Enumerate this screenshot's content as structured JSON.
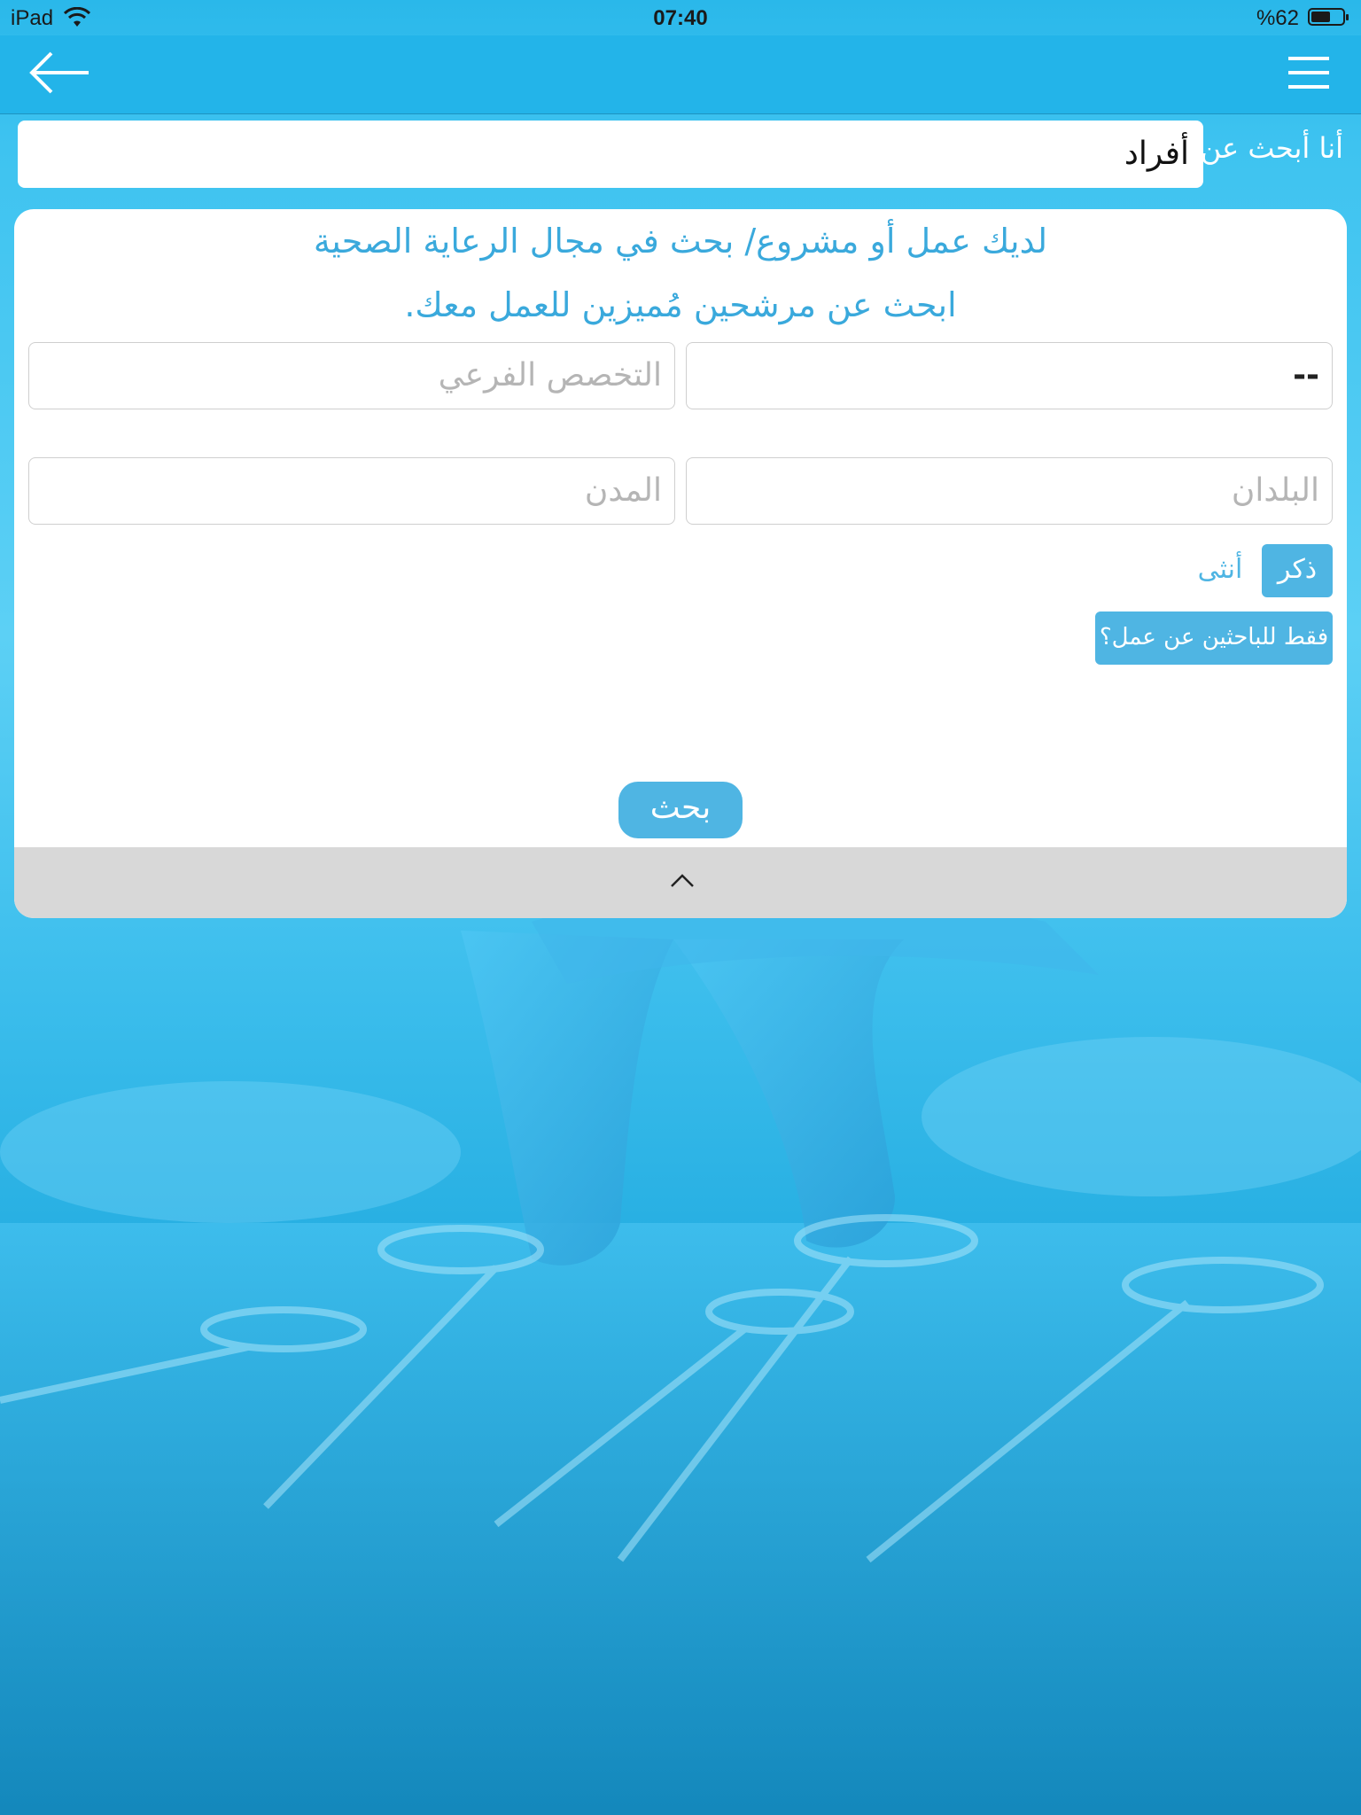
{
  "status_bar": {
    "device": "iPad",
    "time": "07:40",
    "battery": "%62",
    "battery_level": 0.62
  },
  "nav": {
    "back_icon": "back-arrow-icon",
    "menu_icon": "hamburger-menu-icon"
  },
  "search_for": {
    "label": "أنا أبحث عن:",
    "value": "أفراد"
  },
  "card": {
    "title": "لديك عمل أو مشروع/ بحث في مجال الرعاية الصحية",
    "subtitle": "ابحث عن مرشحين مُميزين للعمل معك.",
    "specialty_value": "--",
    "subspecialty_placeholder": "التخصص الفرعي",
    "countries_placeholder": "البلدان",
    "cities_placeholder": "المدن",
    "gender_male": "ذكر",
    "gender_female": "أنثى",
    "jobseekers_only": "فقط للباحثين عن عمل؟",
    "search_button": "بحث",
    "collapse_icon": "chevron-up-icon"
  },
  "colors": {
    "nav": "#23b4e9",
    "accent": "#4fb5e3",
    "heading": "#3aa9dc",
    "collapse_bar": "#d8d8d8"
  }
}
